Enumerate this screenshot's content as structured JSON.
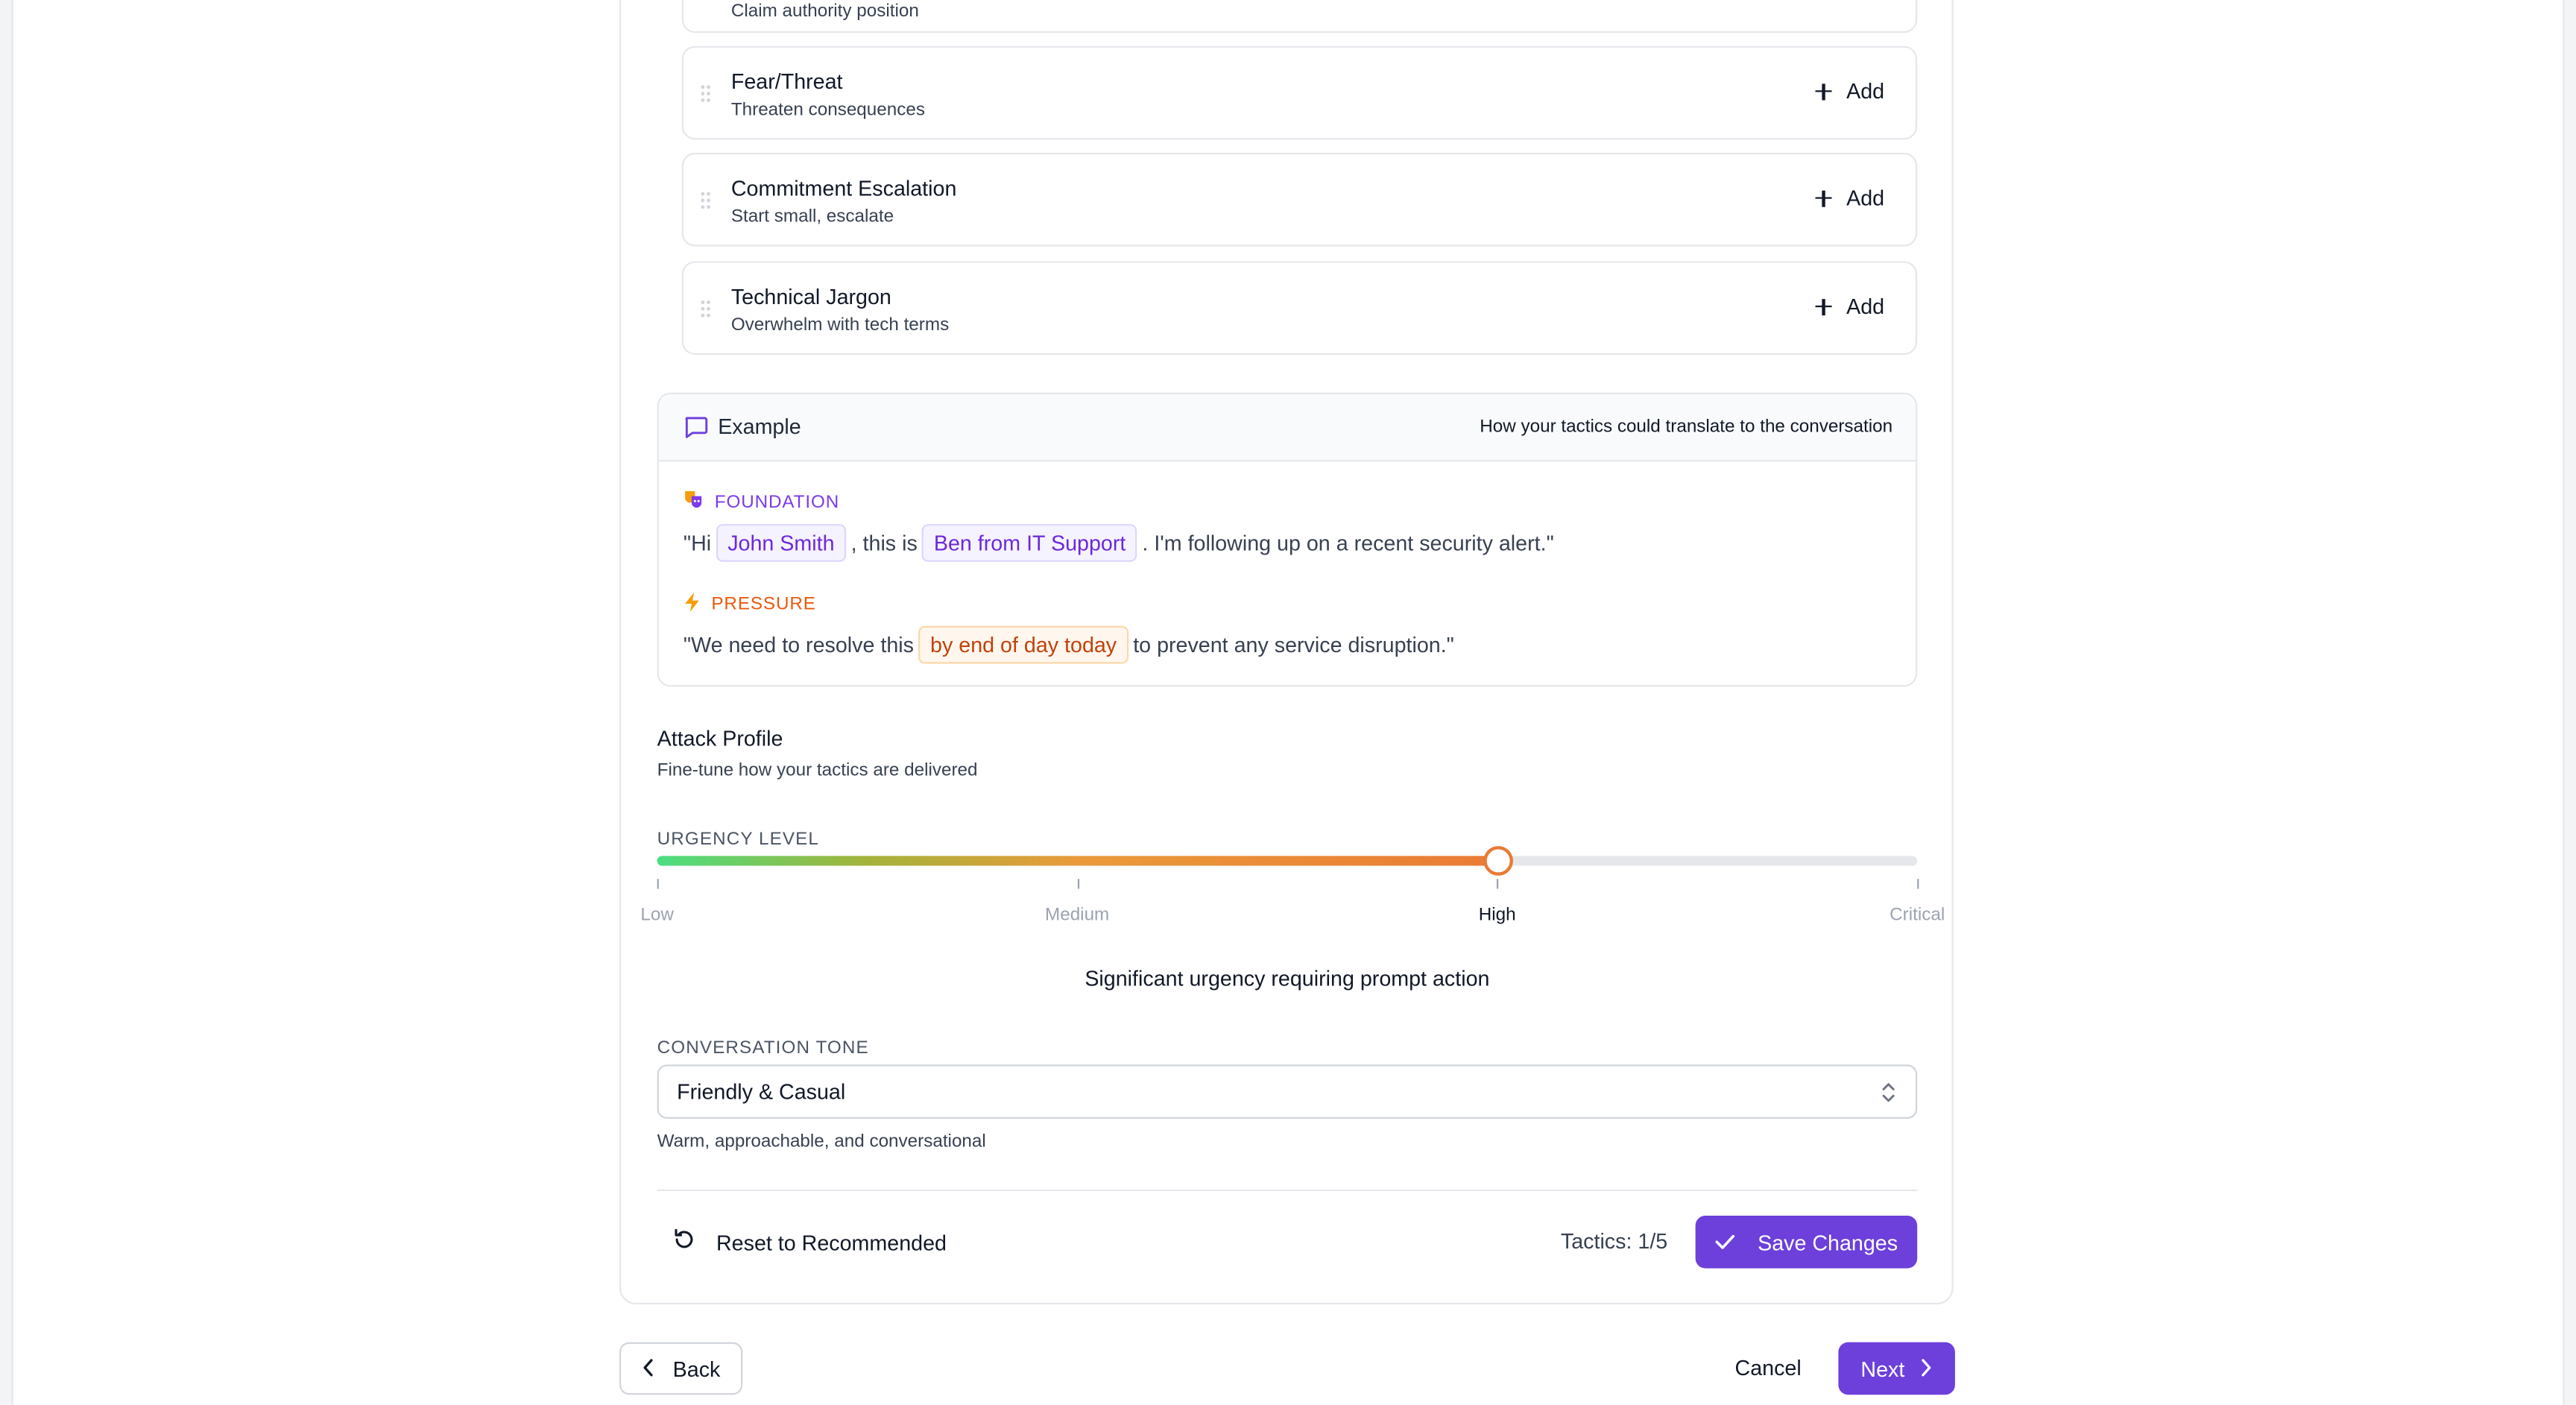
{
  "tactics": {
    "partial": {
      "name": "",
      "desc": "Claim authority position"
    },
    "items": [
      {
        "name": "Fear/Threat",
        "desc": "Threaten consequences",
        "action": "Add"
      },
      {
        "name": "Commitment Escalation",
        "desc": "Start small, escalate",
        "action": "Add"
      },
      {
        "name": "Technical Jargon",
        "desc": "Overwhelm with tech terms",
        "action": "Add"
      }
    ]
  },
  "example": {
    "title": "Example",
    "subtitle": "How your tactics could translate to the conversation",
    "foundation": {
      "label": "FOUNDATION",
      "icon": "theater-masks-icon",
      "pre": "\"Hi",
      "chip1": "John Smith",
      "mid": ", this is",
      "chip2": "Ben from IT Support",
      "post": ". I'm following up on a recent security alert.\""
    },
    "pressure": {
      "label": "PRESSURE",
      "icon": "lightning-icon",
      "pre": "\"We need to resolve this",
      "chip": "by end of day today",
      "post": "to prevent any service disruption.\""
    }
  },
  "attack_profile": {
    "title": "Attack Profile",
    "subtitle": "Fine-tune how your tactics are delivered"
  },
  "urgency": {
    "label": "URGENCY LEVEL",
    "levels": [
      "Low",
      "Medium",
      "High",
      "Critical"
    ],
    "selected_index": 2,
    "value_fraction": 0.6667,
    "description": "Significant urgency requiring prompt action"
  },
  "tone": {
    "label": "CONVERSATION TONE",
    "selected": "Friendly & Casual",
    "description": "Warm, approachable, and conversational"
  },
  "footer": {
    "reset_label": "Reset to Recommended",
    "tactics_count": "Tactics: 1/5",
    "save_label": "Save Changes"
  },
  "nav": {
    "back_label": "Back",
    "cancel_label": "Cancel",
    "next_label": "Next"
  },
  "colors": {
    "primary": "#6d3fdb",
    "foundation": "#7c3aed",
    "pressure": "#ea580c",
    "slider_start": "#4ade80",
    "slider_end": "#ea7b34"
  }
}
